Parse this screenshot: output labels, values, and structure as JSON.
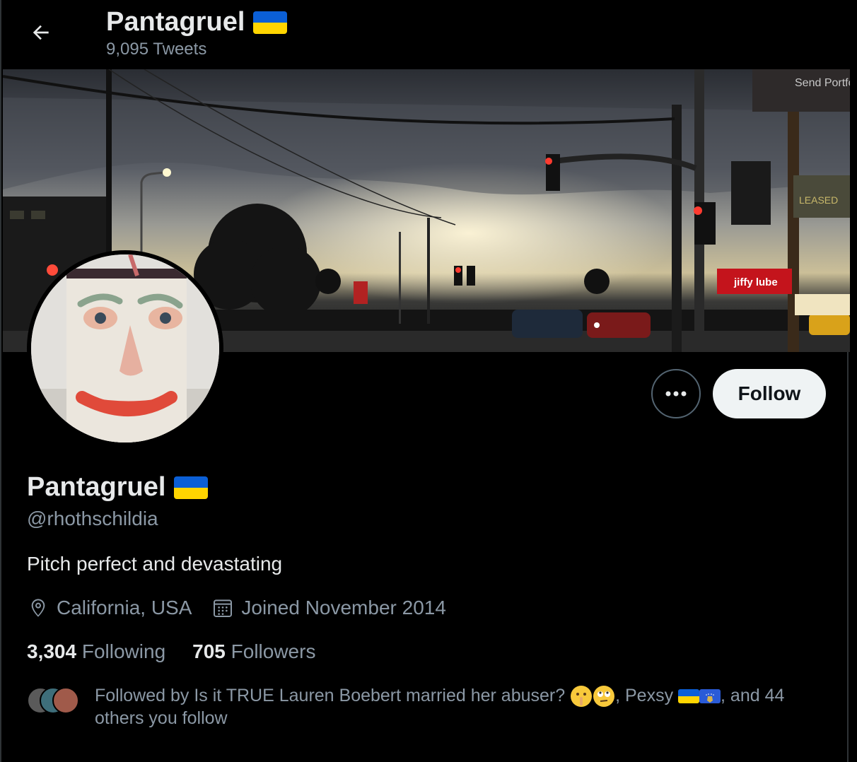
{
  "header": {
    "title": "Pantagruel",
    "tweet_count": "9,095 Tweets"
  },
  "profile": {
    "name": "Pantagruel",
    "handle": "@rhothschildia",
    "bio": "Pitch perfect and devastating",
    "location": "California, USA",
    "joined": "Joined November 2014",
    "following_count": "3,304",
    "following_label": "Following",
    "followers_count": "705",
    "followers_label": "Followers"
  },
  "actions": {
    "follow_label": "Follow"
  },
  "followed_by": {
    "prefix": "Followed by Is it TRUE Lauren Boebert married her abuser?",
    "middle": ", Pexsy",
    "suffix": ", and 44 others you follow"
  },
  "banner_signs": {
    "top_right": "Send Portfolio",
    "store": "jiffy lube",
    "leased": "LEASED"
  },
  "icons": [
    "back-arrow-icon",
    "ukraine-flag-icon",
    "more-icon",
    "location-icon",
    "calendar-icon",
    "kosovo-flag-icon",
    "shushing-face-emoji",
    "eye-roll-emoji"
  ],
  "colors": {
    "background": "#000000",
    "text": "#e7e9ea",
    "secondary_text": "#8b98a5",
    "follow_button_bg": "#eff3f4",
    "flag_blue": "#0b5fd6",
    "flag_yellow": "#ffd500"
  }
}
